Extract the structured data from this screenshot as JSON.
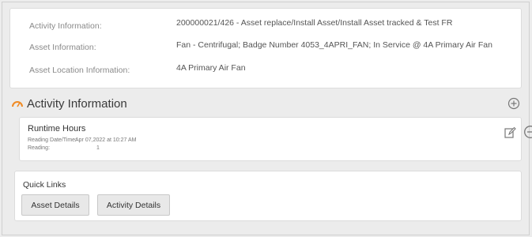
{
  "asset_info": {
    "rows": [
      {
        "label": "Activity Information:",
        "value": "200000021/426 - Asset replace/Install Asset/Install Asset tracked & Test FR"
      },
      {
        "label": "Asset Information:",
        "value": "Fan - Centrifugal; Badge Number 4053_4APRI_FAN; In Service @ 4A Primary Air Fan"
      },
      {
        "label": "Asset Location Information:",
        "value": "4A Primary Air Fan"
      }
    ]
  },
  "activity_section": {
    "title": "Activity Information",
    "icon": "gauge-icon",
    "add_icon": "plus-circle-icon",
    "accent_color": "#f08a24"
  },
  "runtime": {
    "title": "Runtime Hours",
    "date_label": "Reading Date/Time:",
    "date_value": "Apr 07,2022 at 10:27 AM",
    "reading_label": "Reading:",
    "reading_value": "1",
    "edit_icon": "edit-icon",
    "remove_icon": "minus-circle-icon"
  },
  "quick_links": {
    "title": "Quick Links",
    "buttons": [
      "Asset Details",
      "Activity Details"
    ]
  }
}
